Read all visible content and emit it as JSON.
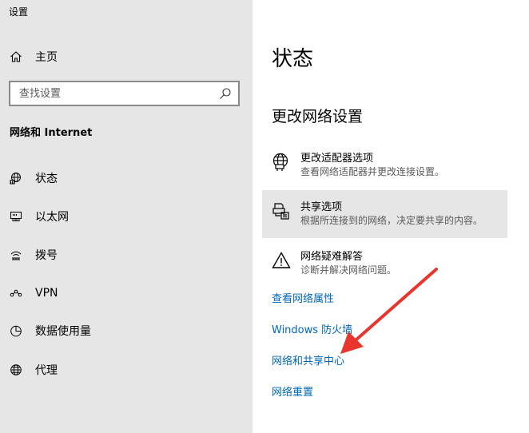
{
  "window": {
    "title": "设置"
  },
  "sidebar": {
    "home_label": "主页",
    "search_placeholder": "查找设置",
    "section_title": "网络和 Internet",
    "items": [
      {
        "label": "状态",
        "icon": "globe-status-icon"
      },
      {
        "label": "以太网",
        "icon": "ethernet-icon"
      },
      {
        "label": "拨号",
        "icon": "dialup-icon"
      },
      {
        "label": "VPN",
        "icon": "vpn-icon"
      },
      {
        "label": "数据使用量",
        "icon": "data-usage-icon"
      },
      {
        "label": "代理",
        "icon": "globe-icon"
      }
    ]
  },
  "main": {
    "title": "状态",
    "subtitle": "更改网络设置",
    "options": [
      {
        "title": "更改适配器选项",
        "desc": "查看网络适配器并更改连接设置。",
        "icon": "adapter-icon"
      },
      {
        "title": "共享选项",
        "desc": "根据所连接到的网络，决定要共享的内容。",
        "icon": "sharing-icon"
      },
      {
        "title": "网络疑难解答",
        "desc": "诊断并解决网络问题。",
        "icon": "warning-icon"
      }
    ],
    "links": [
      "查看网络属性",
      "Windows 防火墙",
      "网络和共享中心",
      "网络重置"
    ]
  },
  "colors": {
    "link": "#0067b8",
    "sidebar_bg": "#e6e6e6",
    "annotation_arrow": "#e8362f"
  }
}
